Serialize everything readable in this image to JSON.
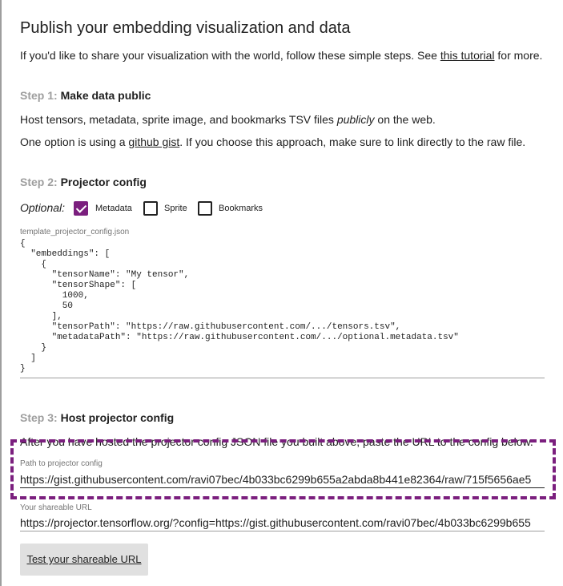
{
  "dialog": {
    "title": "Publish your embedding visualization and data",
    "intro": {
      "before": "If you'd like to share your visualization with the world, follow these simple steps. See ",
      "link": "this tutorial",
      "after": " for more."
    }
  },
  "step1": {
    "num": "Step 1:",
    "heading": "Make data public",
    "line1": {
      "before": "Host tensors, metadata, sprite image, and bookmarks TSV files ",
      "em": "publicly",
      "after": " on the web."
    },
    "line2": {
      "before": "One option is using a ",
      "link": "github gist",
      "after": ". If you choose this approach, make sure to link directly to the raw file."
    }
  },
  "step2": {
    "num": "Step 2:",
    "heading": "Projector config",
    "optional_label": "Optional:",
    "checkboxes": [
      {
        "label": "Metadata",
        "checked": true
      },
      {
        "label": "Sprite",
        "checked": false
      },
      {
        "label": "Bookmarks",
        "checked": false
      }
    ],
    "filename": "template_projector_config.json",
    "code": "{\n  \"embeddings\": [\n    {\n      \"tensorName\": \"My tensor\",\n      \"tensorShape\": [\n        1000,\n        50\n      ],\n      \"tensorPath\": \"https://raw.githubusercontent.com/.../tensors.tsv\",\n      \"metadataPath\": \"https://raw.githubusercontent.com/.../optional.metadata.tsv\"\n    }\n  ]\n}"
  },
  "step3": {
    "num": "Step 3:",
    "heading": "Host projector config",
    "instruction": "After you have hosted the projector config JSON file you built above, paste the URL to the config below.",
    "config_field": {
      "label": "Path to projector config",
      "value": "https://gist.githubusercontent.com/ravi07bec/4b033bc6299b655a2abda8b441e82364/raw/715f5656ae5"
    },
    "share_field": {
      "label": "Your shareable URL",
      "value": "https://projector.tensorflow.org/?config=https://gist.githubusercontent.com/ravi07bec/4b033bc6299b655"
    },
    "test_button": "Test your shareable URL"
  },
  "colors": {
    "accent": "#7b1f7e",
    "step_number": "#9e9e9e",
    "button_bg": "#e0e0e0"
  }
}
